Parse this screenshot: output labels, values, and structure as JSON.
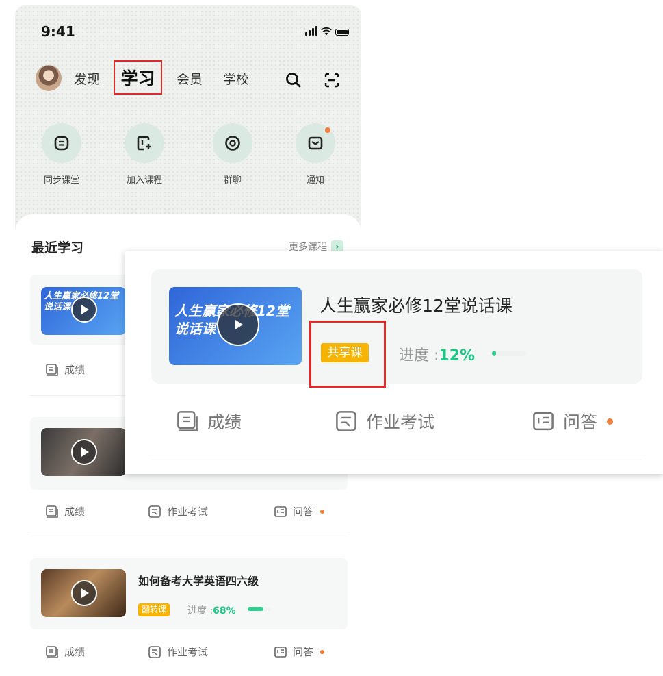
{
  "status_bar": {
    "time": "9:41"
  },
  "top_nav": {
    "tabs": [
      "发现",
      "学习",
      "会员",
      "学校"
    ],
    "active_tab": "学习"
  },
  "quick_actions": [
    {
      "label": "同步课堂",
      "icon": "sync-classroom-icon"
    },
    {
      "label": "加入课程",
      "icon": "join-course-icon"
    },
    {
      "label": "群聊",
      "icon": "group-chat-icon"
    },
    {
      "label": "通知",
      "icon": "notification-icon",
      "has_badge": true
    }
  ],
  "recent": {
    "title": "最近学习",
    "more_label": "更多课程"
  },
  "courses": [
    {
      "thumb_text": "人生赢家必修12堂说话课",
      "actions": [
        "成绩"
      ]
    },
    {
      "actions": [
        "成绩",
        "作业考试",
        "问答"
      ]
    },
    {
      "title": "如何备考大学英语四六级",
      "badge": "翻转课",
      "progress_label": "进度 :",
      "progress_value": "68%",
      "progress": 0.68,
      "actions": [
        "成绩",
        "作业考试",
        "问答"
      ]
    }
  ],
  "popup": {
    "title": "人生赢家必修12堂说话课",
    "badge": "共享课",
    "progress_label": "进度 :",
    "progress_value": "12%",
    "progress": 0.12,
    "actions": [
      "成绩",
      "作业考试",
      "问答"
    ]
  },
  "colors": {
    "accent": "#1fc585",
    "badge": "#f6b400",
    "highlight": "#e02a2a",
    "dot": "#f07f3c"
  }
}
